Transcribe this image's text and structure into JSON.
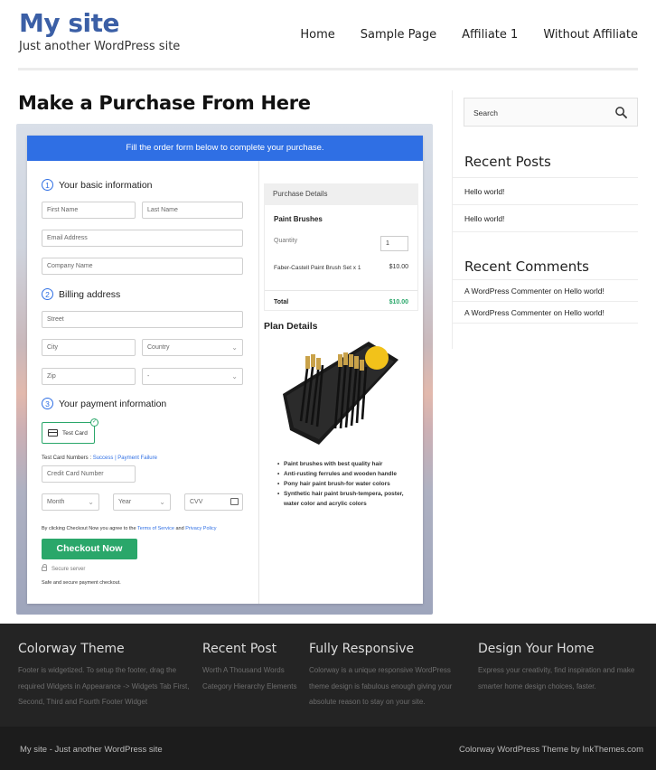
{
  "header": {
    "site_title": "My site",
    "site_description": "Just another WordPress site",
    "nav": [
      "Home",
      "Sample Page",
      "Affiliate 1",
      "Without Affiliate"
    ]
  },
  "main": {
    "page_title": "Make a Purchase From Here"
  },
  "checkout": {
    "banner": "Fill the order form below to complete your purchase.",
    "step1": {
      "number": "1",
      "title": "Your basic information"
    },
    "step2": {
      "number": "2",
      "title": "Billing address"
    },
    "step3": {
      "number": "3",
      "title": "Your payment information"
    },
    "placeholders": {
      "first_name": "First Name",
      "last_name": "Last Name",
      "email": "Email Address",
      "company": "Company Name",
      "street": "Street",
      "city": "City",
      "country": "Country",
      "zip": "Zip",
      "state": "-",
      "card_number": "Credit Card Number",
      "month": "Month",
      "year": "Year",
      "cvv": "CVV"
    },
    "test_card_label": "Test Card",
    "test_numbers_prefix": "Test Card Numbers :",
    "test_success": "Success",
    "test_separator": "|",
    "test_failure": "Payment Failure",
    "terms_prefix": "By clicking Checkout Now you agree to the",
    "terms_link": "Terms of Service",
    "terms_and": "and",
    "privacy_link": "Privacy Policy",
    "checkout_button": "Checkout Now",
    "secure_server": "Secure server",
    "safe_text": "Safe and secure payment checkout.",
    "purchase_details": {
      "heading": "Purchase Details",
      "product": "Paint Brushes",
      "quantity_label": "Quantity",
      "quantity": "1",
      "item_name": "Faber-Castell Paint Brush Set x 1",
      "item_price": "$10.00",
      "total_label": "Total",
      "total": "$10.00"
    },
    "plan_details_title": "Plan Details",
    "features": [
      "Paint brushes with best quality hair",
      "Anti-rusting ferrules and wooden handle",
      "Pony hair paint brush-for water colors",
      "Synthetic hair paint brush-tempera, poster, water color and acrylic colors"
    ]
  },
  "sidebar": {
    "search_placeholder": "Search",
    "recent_posts_title": "Recent Posts",
    "recent_posts": [
      "Hello world!",
      "Hello world!"
    ],
    "recent_comments_title": "Recent Comments",
    "recent_comments": [
      {
        "author": "A WordPress Commenter",
        "on": "on",
        "post": "Hello world!"
      },
      {
        "author": "A WordPress Commenter",
        "on": "on",
        "post": "Hello world!"
      }
    ]
  },
  "footer": {
    "columns": [
      {
        "title": "Colorway Theme",
        "text": "Footer is widgetized. To setup the footer, drag the required Widgets in Appearance -> Widgets Tab First, Second, Third and Fourth Footer Widget"
      },
      {
        "title": "Recent Post",
        "text": "Worth A Thousand Words Category Hierarchy Elements"
      },
      {
        "title": "Fully Responsive",
        "text": "Colorway is a unique responsive WordPress theme design is fabulous enough giving your absolute reason to stay on your site."
      },
      {
        "title": "Design Your Home",
        "text": "Express your creativity, find inspiration and make smarter home design choices, faster."
      }
    ],
    "bottom_left": "My site - Just another WordPress site",
    "bottom_right": "Colorway WordPress Theme by InkThemes.com"
  },
  "colors": {
    "brand_blue": "#3b5fa6",
    "banner_blue": "#2f6fe4",
    "button_green": "#2aa76a",
    "footer_bg": "#242424"
  }
}
